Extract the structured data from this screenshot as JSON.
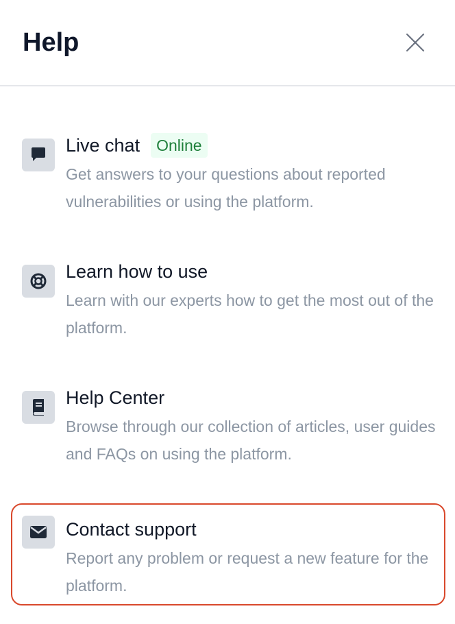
{
  "header": {
    "title": "Help",
    "close_icon": "close-icon"
  },
  "items": [
    {
      "icon": "chat-bubble-icon",
      "title": "Live chat",
      "badge": "Online",
      "description": "Get answers to your questions about reported vulnerabilities or using the platform."
    },
    {
      "icon": "lifebuoy-icon",
      "title": "Learn how to use",
      "description": "Learn with our experts how to get the most out of the platform."
    },
    {
      "icon": "book-icon",
      "title": "Help Center",
      "description": "Browse through our collection of articles, user guides and FAQs on using the platform."
    },
    {
      "icon": "envelope-icon",
      "title": "Contact support",
      "description": "Report any problem or request a new feature for the platform.",
      "highlighted": true
    }
  ],
  "colors": {
    "badge_text": "#1e7f3a",
    "badge_bg": "#ecfdf3",
    "highlight_border": "#d9482b",
    "icon_box_bg": "#d9dde3",
    "description_text": "#8c96a3"
  }
}
